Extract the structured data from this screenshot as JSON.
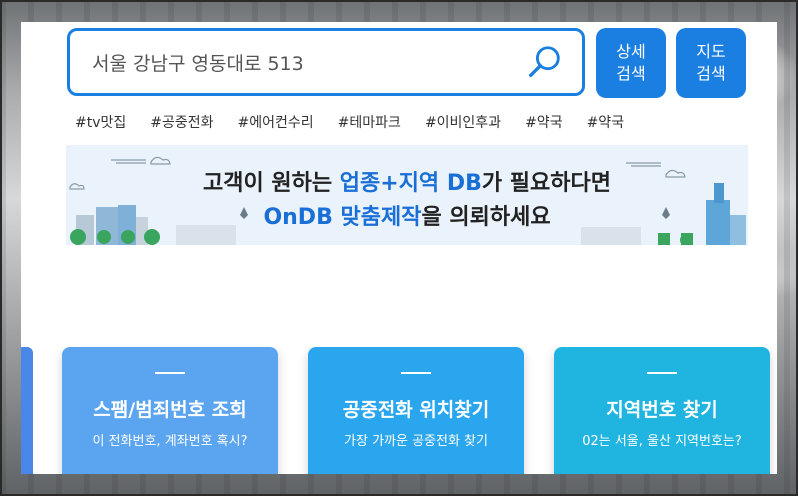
{
  "search": {
    "value": "서울 강남구 영동대로 513"
  },
  "buttons": {
    "detail_search": "상세\n검색",
    "map_search": "지도\n검색"
  },
  "tags": [
    "#tv맛집",
    "#공중전화",
    "#에어컨수리",
    "#테마파크",
    "#이비인후과",
    "#약국",
    "#약국"
  ],
  "banner": {
    "line1_prefix": "고객이 원하는 ",
    "line1_highlight": "업종+지역 DB",
    "line1_suffix": "가 필요하다면",
    "line2_highlight": "OnDB 맞춤제작",
    "line2_suffix": "을 의뢰하세요"
  },
  "cards": [
    {
      "title": "스팸/범죄번호 조회",
      "subtitle": "이 전화번호, 계좌번호 혹시?",
      "color": "#5ba4f0"
    },
    {
      "title": "공중전화 위치찾기",
      "subtitle": "가장 가까운 공중전화 찾기",
      "color": "#2aa6ee"
    },
    {
      "title": "지역번호 찾기",
      "subtitle": "02는 서울, 울산 지역번호는?",
      "color": "#1fb5e0"
    }
  ],
  "colors": {
    "accent": "#1a7fe0"
  }
}
